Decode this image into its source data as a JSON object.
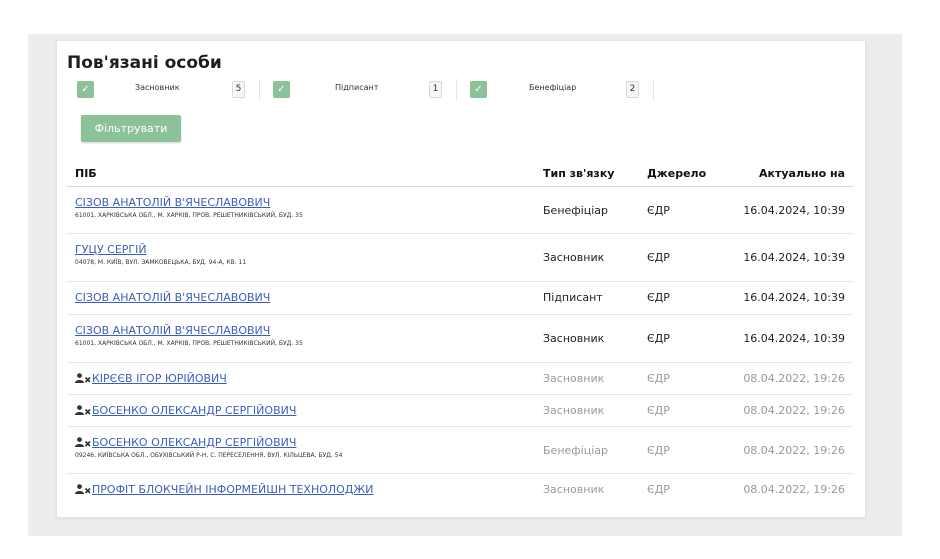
{
  "section_title": "Пов'язані особи",
  "filters": [
    {
      "label": "Засновник",
      "count": "5",
      "checked": true
    },
    {
      "label": "Підписант",
      "count": "1",
      "checked": true
    },
    {
      "label": "Бенефіціар",
      "count": "2",
      "checked": true
    }
  ],
  "filter_button_label": "Фільтрувати",
  "table": {
    "headers": {
      "name": "ПІБ",
      "type": "Тип зв'язку",
      "source": "Джерело",
      "date": "Актуально на"
    },
    "rows": [
      {
        "name": "СІЗОВ АНАТОЛІЙ В'ЯЧЕСЛАВОВИЧ",
        "address": "61001, ХАРКІВСЬКА ОБЛ., М. ХАРКІВ, ПРОВ. РЕШЕТНИКІВСЬКИЙ, БУД. 35",
        "type": "Бенефіціар",
        "source": "ЄДР",
        "date": "16.04.2024, 10:39",
        "active": true
      },
      {
        "name": "ГУЦУ СЕРГІЙ",
        "address": "04078, М. КИЇВ, ВУЛ. ЗАМКОВЕЦЬКА, БУД. 94-А, КВ. 11",
        "type": "Засновник",
        "source": "ЄДР",
        "date": "16.04.2024, 10:39",
        "active": true
      },
      {
        "name": "СІЗОВ АНАТОЛІЙ В'ЯЧЕСЛАВОВИЧ",
        "address": "",
        "type": "Підписант",
        "source": "ЄДР",
        "date": "16.04.2024, 10:39",
        "active": true
      },
      {
        "name": "СІЗОВ АНАТОЛІЙ В'ЯЧЕСЛАВОВИЧ",
        "address": "61001, ХАРКІВСЬКА ОБЛ., М. ХАРКІВ, ПРОВ. РЕШЕТНИКІВСЬКИЙ, БУД. 35",
        "type": "Засновник",
        "source": "ЄДР",
        "date": "16.04.2024, 10:39",
        "active": true
      },
      {
        "name": "КІРЄЄВ ІГОР ЮРІЙОВИЧ",
        "address": "",
        "type": "Засновник",
        "source": "ЄДР",
        "date": "08.04.2022, 19:26",
        "active": false
      },
      {
        "name": "БОСЕНКО ОЛЕКСАНДР СЕРГІЙОВИЧ",
        "address": "",
        "type": "Засновник",
        "source": "ЄДР",
        "date": "08.04.2022, 19:26",
        "active": false
      },
      {
        "name": "БОСЕНКО ОЛЕКСАНДР СЕРГІЙОВИЧ",
        "address": "09246, КИЇВСЬКА ОБЛ., ОБУХІВСЬКИЙ Р-Н, С. ПЕРЕСЕЛЕННЯ, ВУЛ. КІЛЬЦЕВА, БУД. 54",
        "type": "Бенефіціар",
        "source": "ЄДР",
        "date": "08.04.2022, 19:26",
        "active": false
      },
      {
        "name": "ПРОФІТ БЛОКЧЕЙН ІНФОРМЕЙШН ТЕХНОЛОДЖИ",
        "address": "",
        "type": "Засновник",
        "source": "ЄДР",
        "date": "08.04.2022, 19:26",
        "active": false
      }
    ]
  },
  "icons": {
    "checkbox": "check-icon",
    "removed_person": "user-removed-icon"
  },
  "colors": {
    "accent": "#8bc29a",
    "link": "#3a5fc0",
    "inactive_text": "#9a9a9a"
  }
}
